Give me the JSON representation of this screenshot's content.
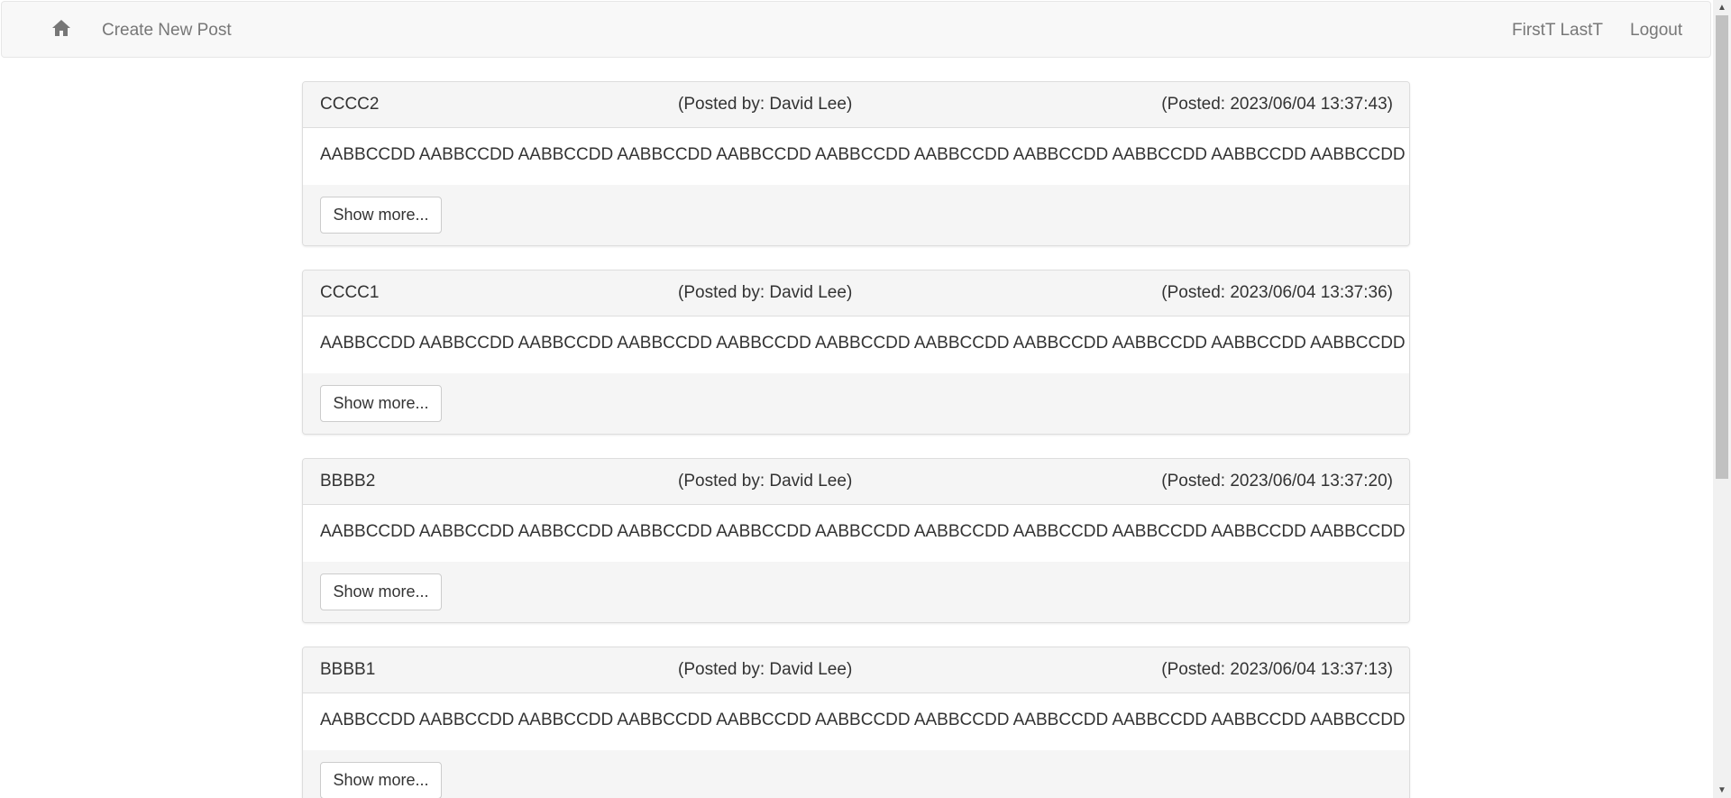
{
  "nav": {
    "home_icon": "home-icon",
    "create_label": "Create New Post",
    "user_label": "FirstT LastT",
    "logout_label": "Logout"
  },
  "posts": [
    {
      "title": "CCCC2",
      "author": "(Posted by: David Lee)",
      "date": "(Posted: 2023/06/04 13:37:43)",
      "body": "AABBCCDD AABBCCDD AABBCCDD AABBCCDD AABBCCDD AABBCCDD AABBCCDD AABBCCDD AABBCCDD AABBCCDD AABBCCDD",
      "button": "Show more..."
    },
    {
      "title": "CCCC1",
      "author": "(Posted by: David Lee)",
      "date": "(Posted: 2023/06/04 13:37:36)",
      "body": "AABBCCDD AABBCCDD AABBCCDD AABBCCDD AABBCCDD AABBCCDD AABBCCDD AABBCCDD AABBCCDD AABBCCDD AABBCCDD",
      "button": "Show more..."
    },
    {
      "title": "BBBB2",
      "author": "(Posted by: David Lee)",
      "date": "(Posted: 2023/06/04 13:37:20)",
      "body": "AABBCCDD AABBCCDD AABBCCDD AABBCCDD AABBCCDD AABBCCDD AABBCCDD AABBCCDD AABBCCDD AABBCCDD AABBCCDD",
      "button": "Show more..."
    },
    {
      "title": "BBBB1",
      "author": "(Posted by: David Lee)",
      "date": "(Posted: 2023/06/04 13:37:13)",
      "body": "AABBCCDD AABBCCDD AABBCCDD AABBCCDD AABBCCDD AABBCCDD AABBCCDD AABBCCDD AABBCCDD AABBCCDD AABBCCDD",
      "button": "Show more..."
    }
  ],
  "colors": {
    "navbar_bg": "#f8f8f8",
    "nav_text": "#777777",
    "panel_bg": "#f5f5f5",
    "text": "#333333"
  }
}
